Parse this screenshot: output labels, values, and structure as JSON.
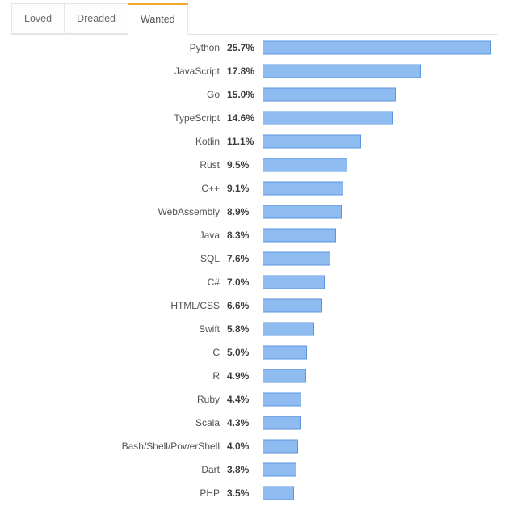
{
  "tabs": [
    {
      "label": "Loved",
      "active": false
    },
    {
      "label": "Dreaded",
      "active": false
    },
    {
      "label": "Wanted",
      "active": true
    }
  ],
  "colors": {
    "bar_fill": "#8fbcf0",
    "bar_border": "#5b94e0",
    "active_tab_accent": "#f0a830",
    "tab_border": "#e6e6e6",
    "label_text": "#505050",
    "value_text": "#3c3c3c"
  },
  "chart_data": {
    "type": "bar",
    "orientation": "horizontal",
    "title": "",
    "xlabel": "",
    "ylabel": "",
    "xlim": [
      0,
      27
    ],
    "grid": false,
    "legend": false,
    "value_suffix": "%",
    "categories": [
      "Python",
      "JavaScript",
      "Go",
      "TypeScript",
      "Kotlin",
      "Rust",
      "C++",
      "WebAssembly",
      "Java",
      "SQL",
      "C#",
      "HTML/CSS",
      "Swift",
      "C",
      "R",
      "Ruby",
      "Scala",
      "Bash/Shell/PowerShell",
      "Dart",
      "PHP"
    ],
    "values": [
      25.7,
      17.8,
      15.0,
      14.6,
      11.1,
      9.5,
      9.1,
      8.9,
      8.3,
      7.6,
      7.0,
      6.6,
      5.8,
      5.0,
      4.9,
      4.4,
      4.3,
      4.0,
      3.8,
      3.5
    ],
    "value_labels": [
      "25.7%",
      "17.8%",
      "15.0%",
      "14.6%",
      "11.1%",
      "9.5%",
      "9.1%",
      "8.9%",
      "8.3%",
      "7.6%",
      "7.0%",
      "6.6%",
      "5.8%",
      "5.0%",
      "4.9%",
      "4.4%",
      "4.3%",
      "4.0%",
      "3.8%",
      "3.5%"
    ]
  }
}
